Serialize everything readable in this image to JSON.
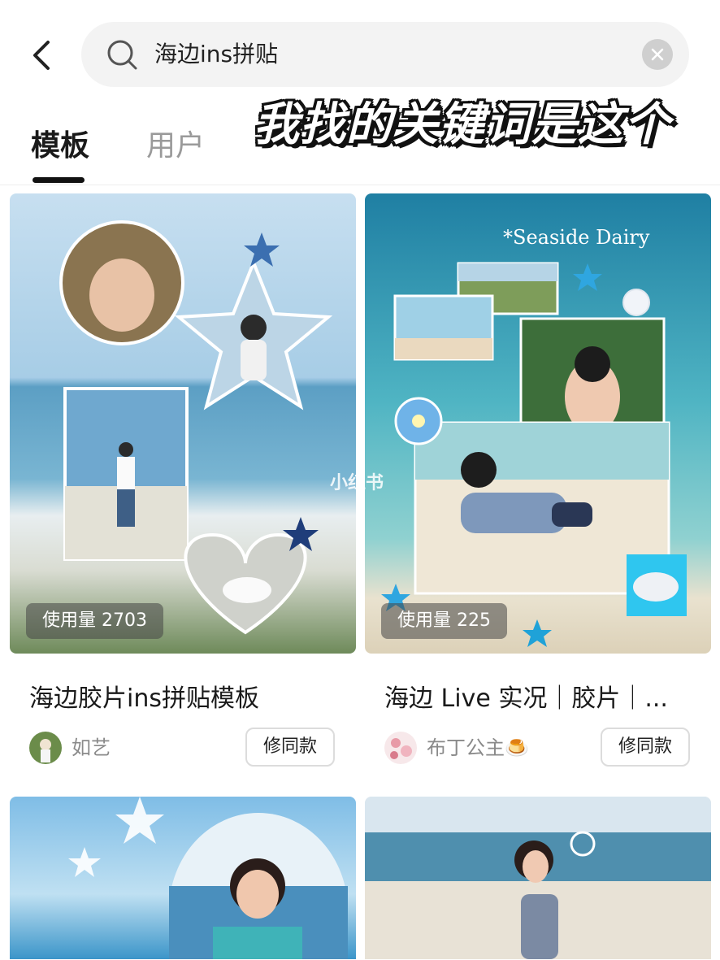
{
  "header": {
    "back_icon": "chevron-left-icon",
    "search_query": "海边ins拼贴",
    "search_icon": "search-icon",
    "clear_icon": "close-icon"
  },
  "annotation": "我找的关键词是这个",
  "tabs": [
    {
      "label": "模板",
      "active": true
    },
    {
      "label": "用户",
      "active": false
    }
  ],
  "watermark": "小红书",
  "cards": [
    {
      "usage": "使用量 2703",
      "title": "海边胶片ins拼贴模板",
      "author": "如艺",
      "action": "修同款"
    },
    {
      "usage": "使用量 225",
      "title": "海边 Live 实况｜胶片｜...",
      "author": "布丁公主🍮",
      "action": "修同款",
      "image_caption": "*Seaside Dairy"
    }
  ],
  "colors": {
    "accent_dark": "#111111",
    "muted_text": "#8a8a8a",
    "search_bg": "#f3f3f3",
    "sea_blue": "#5ba4c8",
    "sky_blue": "#b9dcef"
  }
}
